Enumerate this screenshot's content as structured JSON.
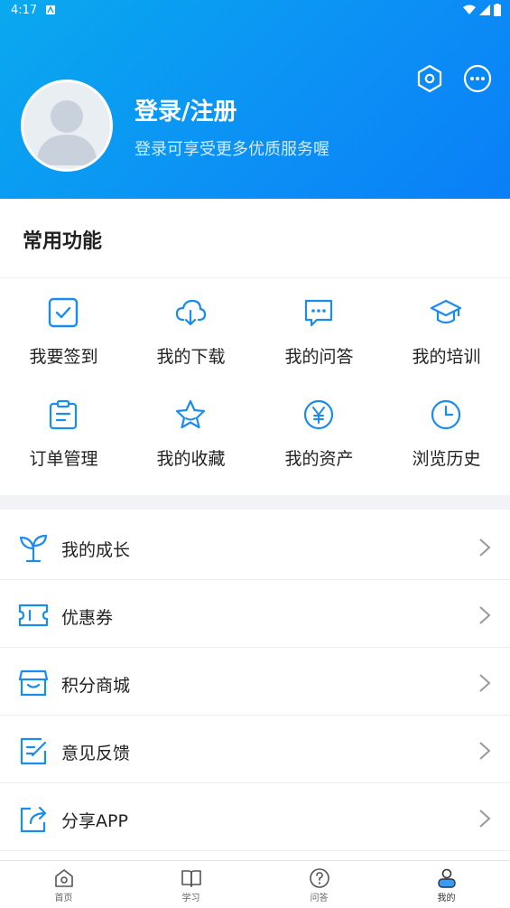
{
  "status": {
    "time": "4:17"
  },
  "profile": {
    "login_title": "登录/注册",
    "login_subtitle": "登录可享受更多优质服务喔"
  },
  "common": {
    "title": "常用功能",
    "items": [
      {
        "label": "我要签到",
        "icon": "checkin-icon"
      },
      {
        "label": "我的下载",
        "icon": "cloud-download-icon"
      },
      {
        "label": "我的问答",
        "icon": "chat-bubble-icon"
      },
      {
        "label": "我的培训",
        "icon": "graduation-cap-icon"
      },
      {
        "label": "订单管理",
        "icon": "clipboard-icon"
      },
      {
        "label": "我的收藏",
        "icon": "star-icon"
      },
      {
        "label": "我的资产",
        "icon": "yen-coin-icon"
      },
      {
        "label": "浏览历史",
        "icon": "clock-icon"
      }
    ]
  },
  "menu": [
    {
      "label": "我的成长",
      "icon": "sprout-icon"
    },
    {
      "label": "优惠券",
      "icon": "coupon-icon"
    },
    {
      "label": "积分商城",
      "icon": "store-icon"
    },
    {
      "label": "意见反馈",
      "icon": "feedback-edit-icon"
    },
    {
      "label": "分享APP",
      "icon": "share-icon"
    }
  ],
  "tabs": [
    {
      "label": "首页",
      "icon": "home-icon"
    },
    {
      "label": "学习",
      "icon": "book-icon"
    },
    {
      "label": "问答",
      "icon": "question-icon"
    },
    {
      "label": "我的",
      "icon": "user-icon",
      "active": true
    }
  ],
  "colors": {
    "accent": "#1a8cf0",
    "header_start": "#0aa9ef",
    "header_end": "#0a7ff7"
  }
}
